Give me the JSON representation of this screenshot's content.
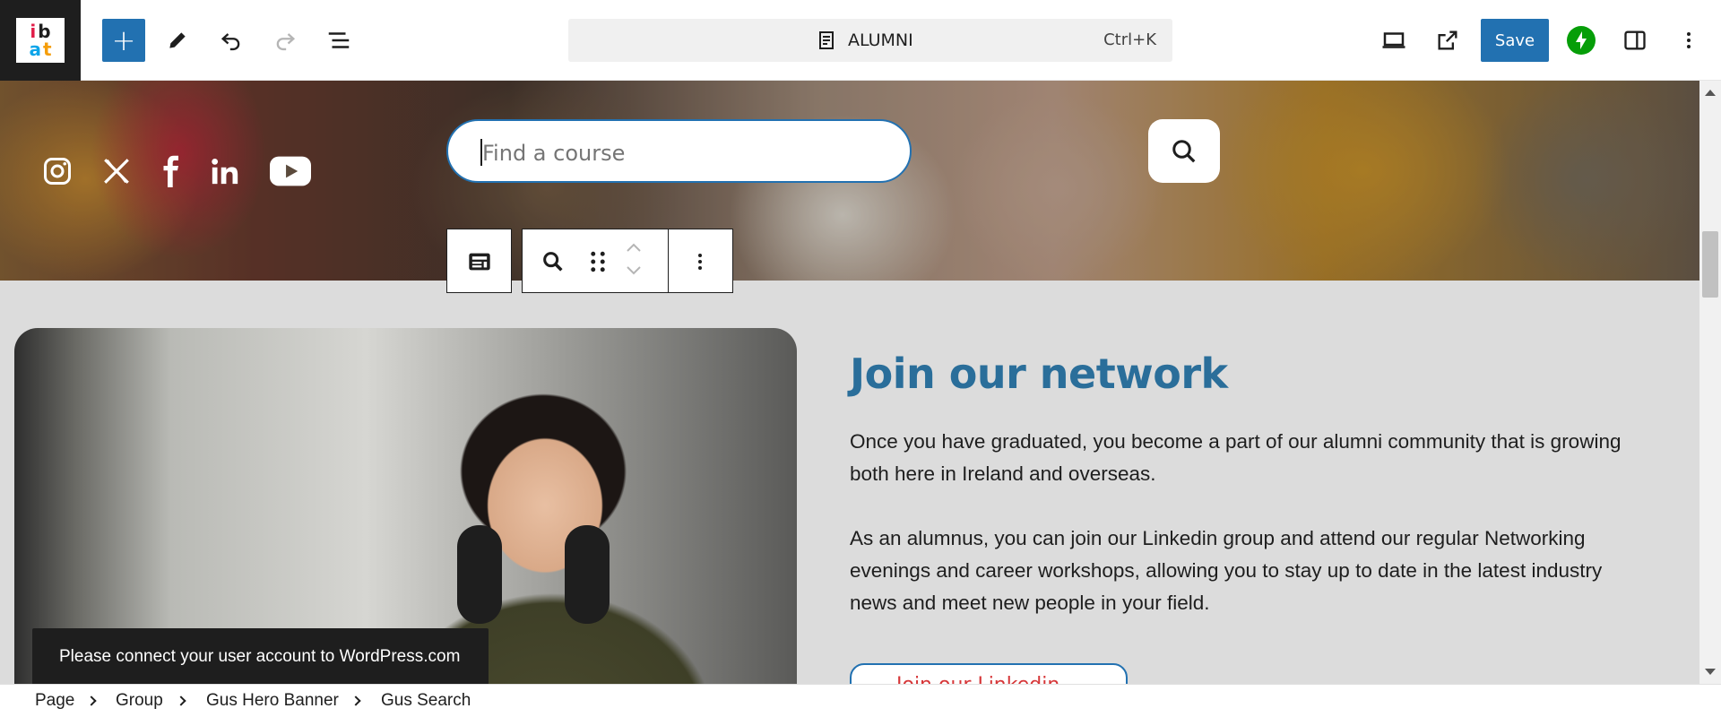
{
  "toolbar": {
    "document_title": "ALUMNI",
    "shortcut": "Ctrl+K",
    "save_label": "Save",
    "icons": [
      "add-block-icon",
      "pencil-tool-icon",
      "undo-icon",
      "redo-icon",
      "document-overview-icon",
      "page-icon",
      "desktop-preview-icon",
      "external-view-icon",
      "jetpack-icon",
      "sidebar-settings-icon",
      "more-options-icon"
    ]
  },
  "logo": {
    "line1": [
      "i",
      "b"
    ],
    "line2": [
      "a",
      "t"
    ]
  },
  "hero": {
    "social": [
      "instagram",
      "x",
      "facebook",
      "linkedin",
      "youtube"
    ],
    "search_placeholder": "Find a course"
  },
  "section": {
    "heading": "Join our network",
    "paragraph1": "Once you have graduated, you become a part of our alumni community that is growing both here in Ireland and overseas.",
    "paragraph2": "As an alumnus, you can join our Linkedin group and attend our regular Networking evenings and career workshops, allowing you to stay up to date in the latest industry news and meet new people in your field.",
    "cta_label": "Join our Linkedin"
  },
  "toast": "Please connect your user account to WordPress.com",
  "breadcrumb": [
    "Page",
    "Group",
    "Gus Hero Banner",
    "Gus Search"
  ],
  "colors": {
    "accent": "#2271b1",
    "heading": "#2a6e9a",
    "cta_text": "#d63638",
    "jetpack": "#069e08"
  }
}
